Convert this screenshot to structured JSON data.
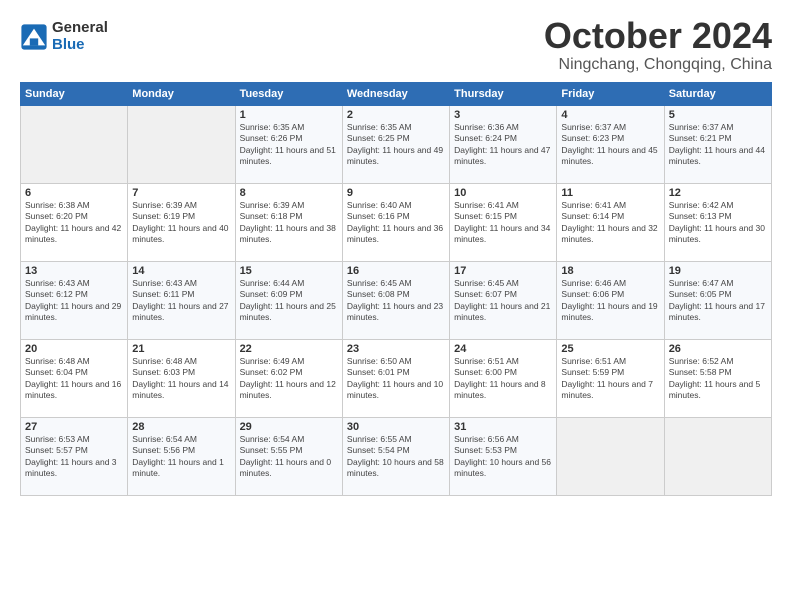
{
  "logo": {
    "general": "General",
    "blue": "Blue"
  },
  "header": {
    "month": "October 2024",
    "location": "Ningchang, Chongqing, China"
  },
  "weekdays": [
    "Sunday",
    "Monday",
    "Tuesday",
    "Wednesday",
    "Thursday",
    "Friday",
    "Saturday"
  ],
  "weeks": [
    [
      {
        "day": "",
        "info": ""
      },
      {
        "day": "",
        "info": ""
      },
      {
        "day": "1",
        "info": "Sunrise: 6:35 AM\nSunset: 6:26 PM\nDaylight: 11 hours and 51 minutes."
      },
      {
        "day": "2",
        "info": "Sunrise: 6:35 AM\nSunset: 6:25 PM\nDaylight: 11 hours and 49 minutes."
      },
      {
        "day": "3",
        "info": "Sunrise: 6:36 AM\nSunset: 6:24 PM\nDaylight: 11 hours and 47 minutes."
      },
      {
        "day": "4",
        "info": "Sunrise: 6:37 AM\nSunset: 6:23 PM\nDaylight: 11 hours and 45 minutes."
      },
      {
        "day": "5",
        "info": "Sunrise: 6:37 AM\nSunset: 6:21 PM\nDaylight: 11 hours and 44 minutes."
      }
    ],
    [
      {
        "day": "6",
        "info": "Sunrise: 6:38 AM\nSunset: 6:20 PM\nDaylight: 11 hours and 42 minutes."
      },
      {
        "day": "7",
        "info": "Sunrise: 6:39 AM\nSunset: 6:19 PM\nDaylight: 11 hours and 40 minutes."
      },
      {
        "day": "8",
        "info": "Sunrise: 6:39 AM\nSunset: 6:18 PM\nDaylight: 11 hours and 38 minutes."
      },
      {
        "day": "9",
        "info": "Sunrise: 6:40 AM\nSunset: 6:16 PM\nDaylight: 11 hours and 36 minutes."
      },
      {
        "day": "10",
        "info": "Sunrise: 6:41 AM\nSunset: 6:15 PM\nDaylight: 11 hours and 34 minutes."
      },
      {
        "day": "11",
        "info": "Sunrise: 6:41 AM\nSunset: 6:14 PM\nDaylight: 11 hours and 32 minutes."
      },
      {
        "day": "12",
        "info": "Sunrise: 6:42 AM\nSunset: 6:13 PM\nDaylight: 11 hours and 30 minutes."
      }
    ],
    [
      {
        "day": "13",
        "info": "Sunrise: 6:43 AM\nSunset: 6:12 PM\nDaylight: 11 hours and 29 minutes."
      },
      {
        "day": "14",
        "info": "Sunrise: 6:43 AM\nSunset: 6:11 PM\nDaylight: 11 hours and 27 minutes."
      },
      {
        "day": "15",
        "info": "Sunrise: 6:44 AM\nSunset: 6:09 PM\nDaylight: 11 hours and 25 minutes."
      },
      {
        "day": "16",
        "info": "Sunrise: 6:45 AM\nSunset: 6:08 PM\nDaylight: 11 hours and 23 minutes."
      },
      {
        "day": "17",
        "info": "Sunrise: 6:45 AM\nSunset: 6:07 PM\nDaylight: 11 hours and 21 minutes."
      },
      {
        "day": "18",
        "info": "Sunrise: 6:46 AM\nSunset: 6:06 PM\nDaylight: 11 hours and 19 minutes."
      },
      {
        "day": "19",
        "info": "Sunrise: 6:47 AM\nSunset: 6:05 PM\nDaylight: 11 hours and 17 minutes."
      }
    ],
    [
      {
        "day": "20",
        "info": "Sunrise: 6:48 AM\nSunset: 6:04 PM\nDaylight: 11 hours and 16 minutes."
      },
      {
        "day": "21",
        "info": "Sunrise: 6:48 AM\nSunset: 6:03 PM\nDaylight: 11 hours and 14 minutes."
      },
      {
        "day": "22",
        "info": "Sunrise: 6:49 AM\nSunset: 6:02 PM\nDaylight: 11 hours and 12 minutes."
      },
      {
        "day": "23",
        "info": "Sunrise: 6:50 AM\nSunset: 6:01 PM\nDaylight: 11 hours and 10 minutes."
      },
      {
        "day": "24",
        "info": "Sunrise: 6:51 AM\nSunset: 6:00 PM\nDaylight: 11 hours and 8 minutes."
      },
      {
        "day": "25",
        "info": "Sunrise: 6:51 AM\nSunset: 5:59 PM\nDaylight: 11 hours and 7 minutes."
      },
      {
        "day": "26",
        "info": "Sunrise: 6:52 AM\nSunset: 5:58 PM\nDaylight: 11 hours and 5 minutes."
      }
    ],
    [
      {
        "day": "27",
        "info": "Sunrise: 6:53 AM\nSunset: 5:57 PM\nDaylight: 11 hours and 3 minutes."
      },
      {
        "day": "28",
        "info": "Sunrise: 6:54 AM\nSunset: 5:56 PM\nDaylight: 11 hours and 1 minute."
      },
      {
        "day": "29",
        "info": "Sunrise: 6:54 AM\nSunset: 5:55 PM\nDaylight: 11 hours and 0 minutes."
      },
      {
        "day": "30",
        "info": "Sunrise: 6:55 AM\nSunset: 5:54 PM\nDaylight: 10 hours and 58 minutes."
      },
      {
        "day": "31",
        "info": "Sunrise: 6:56 AM\nSunset: 5:53 PM\nDaylight: 10 hours and 56 minutes."
      },
      {
        "day": "",
        "info": ""
      },
      {
        "day": "",
        "info": ""
      }
    ]
  ]
}
